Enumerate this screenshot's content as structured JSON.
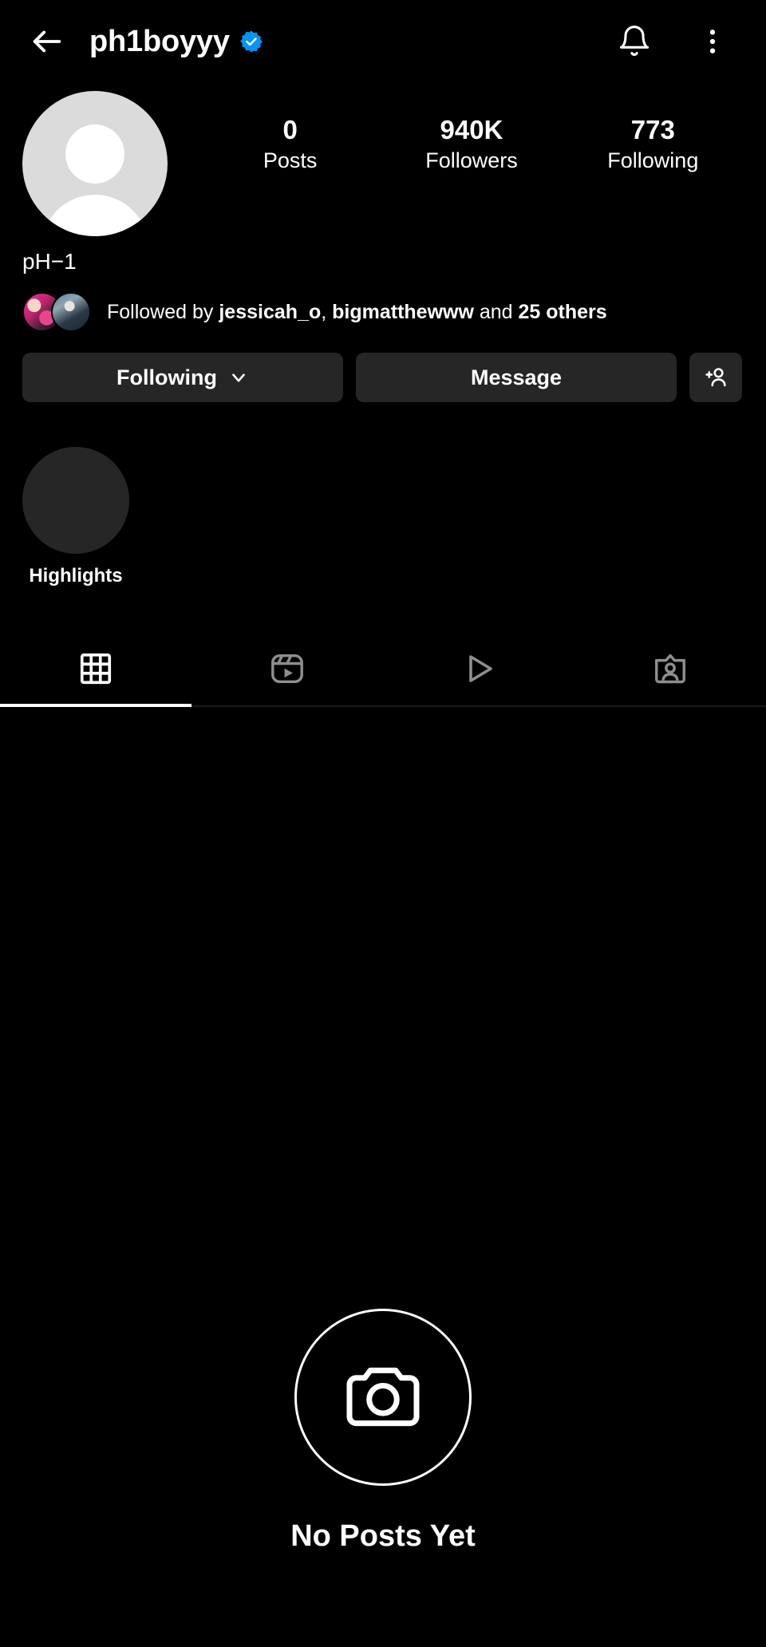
{
  "header": {
    "back_icon": "arrow-left-icon",
    "username": "ph1boyyy",
    "verified_icon": "verified-badge-icon",
    "verified_color": "#0095F6",
    "notifications_icon": "bell-icon",
    "more_icon": "more-vertical-icon"
  },
  "profile": {
    "avatar_icon": "default-avatar-icon",
    "display_name": "pH−1",
    "stats": [
      {
        "value": "0",
        "label": "Posts"
      },
      {
        "value": "940K",
        "label": "Followers"
      },
      {
        "value": "773",
        "label": "Following"
      }
    ],
    "followed_by": {
      "prefix": "Followed by ",
      "name_1": "jessicah_o",
      "separator": ", ",
      "name_2": "bigmatthewww",
      "conjunction": " and ",
      "others": "25 others"
    }
  },
  "actions": {
    "following_label": "Following",
    "following_chevron_icon": "chevron-down-icon",
    "message_label": "Message",
    "add_user_icon": "add-person-icon"
  },
  "highlights": {
    "label": "Highlights"
  },
  "tabs": [
    {
      "name": "grid",
      "icon": "grid-icon",
      "active": true
    },
    {
      "name": "reels",
      "icon": "reels-icon",
      "active": false
    },
    {
      "name": "videos",
      "icon": "play-icon",
      "active": false
    },
    {
      "name": "tagged",
      "icon": "tagged-person-icon",
      "active": false
    }
  ],
  "empty_state": {
    "icon": "camera-icon",
    "title": "No Posts Yet"
  },
  "colors": {
    "background": "#000000",
    "button": "#262626",
    "text": "#ffffff",
    "inactive_icon": "#8e8e8e",
    "avatar_placeholder": "#dbdbdb"
  }
}
